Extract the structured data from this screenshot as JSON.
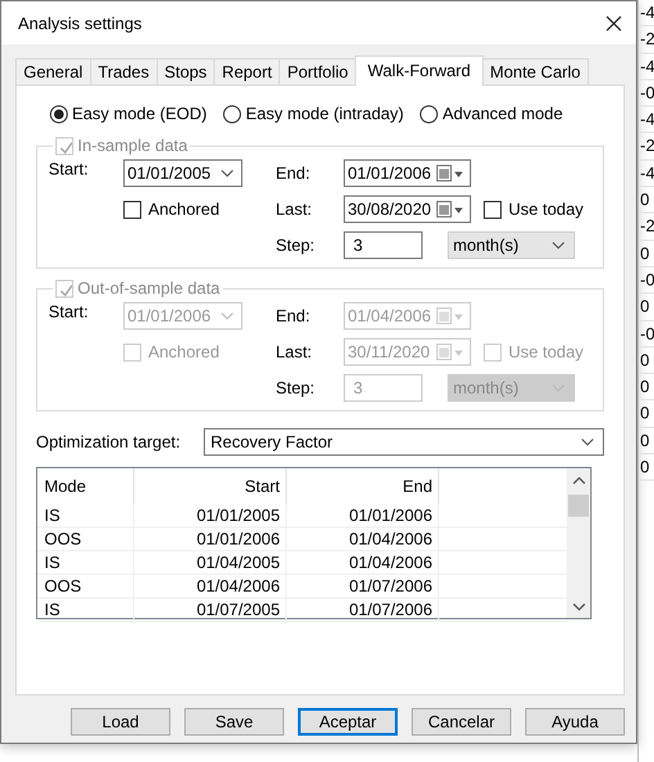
{
  "window": {
    "title": "Analysis settings"
  },
  "tabs": [
    {
      "label": "General",
      "selected": false
    },
    {
      "label": "Trades",
      "selected": false
    },
    {
      "label": "Stops",
      "selected": false
    },
    {
      "label": "Report",
      "selected": false
    },
    {
      "label": "Portfolio",
      "selected": false
    },
    {
      "label": "Walk-Forward",
      "selected": true
    },
    {
      "label": "Monte Carlo",
      "selected": false
    }
  ],
  "modes": [
    {
      "label": "Easy mode (EOD)",
      "selected": true
    },
    {
      "label": "Easy mode (intraday)",
      "selected": false
    },
    {
      "label": "Advanced mode",
      "selected": false
    }
  ],
  "sections": [
    {
      "title": "In-sample data",
      "checked": true,
      "checkbox_disabled": true,
      "disabled": false,
      "start_label": "Start:",
      "start": "01/01/2005",
      "anchored_label": "Anchored",
      "anchored": false,
      "end_label": "End:",
      "end": "01/01/2006",
      "last_label": "Last:",
      "last": "30/08/2020",
      "use_today_label": "Use today",
      "use_today": false,
      "step_label": "Step:",
      "step": "3",
      "step_unit": "month(s)"
    },
    {
      "title": "Out-of-sample data",
      "checked": true,
      "checkbox_disabled": true,
      "disabled": true,
      "start_label": "Start:",
      "start": "01/01/2006",
      "anchored_label": "Anchored",
      "anchored": false,
      "end_label": "End:",
      "end": "01/04/2006",
      "last_label": "Last:",
      "last": "30/11/2020",
      "use_today_label": "Use today",
      "use_today": false,
      "step_label": "Step:",
      "step": "3",
      "step_unit": "month(s)"
    }
  ],
  "optimization_target": {
    "label": "Optimization target:",
    "value": "Recovery Factor"
  },
  "table": {
    "columns": [
      "Mode",
      "Start",
      "End"
    ],
    "rows": [
      [
        "IS",
        "01/01/2005",
        "01/01/2006"
      ],
      [
        "OOS",
        "01/01/2006",
        "01/04/2006"
      ],
      [
        "IS",
        "01/04/2005",
        "01/04/2006"
      ],
      [
        "OOS",
        "01/04/2006",
        "01/07/2006"
      ],
      [
        "IS",
        "01/07/2005",
        "01/07/2006"
      ]
    ]
  },
  "buttons": [
    {
      "label": "Load",
      "default": false
    },
    {
      "label": "Save",
      "default": false
    },
    {
      "label": "Aceptar",
      "default": true
    },
    {
      "label": "Cancelar",
      "default": false
    },
    {
      "label": "Ayuda",
      "default": false
    }
  ],
  "background_column": [
    "-4",
    "-2",
    "-4",
    "-0",
    "-4",
    "-2",
    "-4",
    "0",
    "-2",
    "0",
    "-0",
    "0",
    "-0",
    "0",
    "0",
    "0",
    "0",
    "0"
  ]
}
